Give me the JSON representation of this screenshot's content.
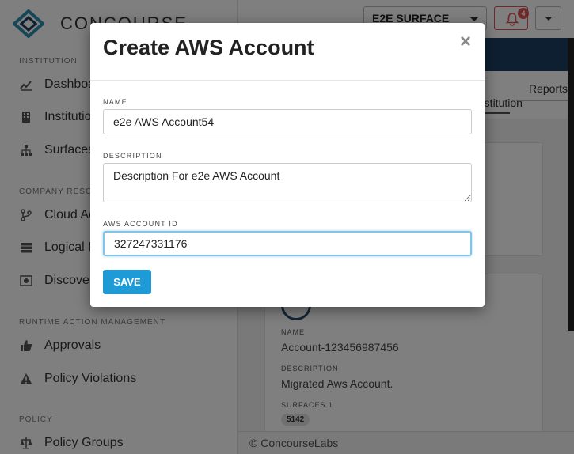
{
  "app": {
    "logo_text": "CONCOURSE"
  },
  "topbar": {
    "surface_select": "E2E SURFACE",
    "notification_count": "4"
  },
  "sidebar": {
    "sections": [
      {
        "label": "INSTITUTION",
        "items": [
          {
            "label": "Dashboard",
            "icon": "chart-line-icon"
          },
          {
            "label": "Institution",
            "icon": "building-icon"
          },
          {
            "label": "Surfaces",
            "icon": "sitemap-icon"
          }
        ]
      },
      {
        "label": "COMPANY RESOURCES",
        "items": [
          {
            "label": "Cloud Accounts",
            "icon": "branch-icon"
          },
          {
            "label": "Logical Deployments",
            "icon": "server-icon"
          },
          {
            "label": "Discovery",
            "icon": "discover-icon"
          }
        ]
      },
      {
        "label": "RUNTIME ACTION MANAGEMENT",
        "items": [
          {
            "label": "Approvals",
            "icon": "thumbs-up-icon"
          },
          {
            "label": "Policy Violations",
            "icon": "warning-icon"
          }
        ]
      },
      {
        "label": "POLICY",
        "items": [
          {
            "label": "Policy Groups",
            "icon": "balance-scale-icon"
          }
        ]
      }
    ]
  },
  "main": {
    "tabs": [
      {
        "label": "Institution"
      },
      {
        "label": "Reports"
      }
    ],
    "account_card": {
      "name_label": "NAME",
      "name_value": "Account-123456987456",
      "description_label": "DESCRIPTION",
      "description_value": "Migrated Aws Account.",
      "surfaces_label": "SURFACES 1",
      "surfaces_badge": "5142"
    },
    "footer": "© ConcourseLabs"
  },
  "modal": {
    "title": "Create AWS Account",
    "close_glyph": "×",
    "fields": {
      "name": {
        "label": "NAME",
        "value": "e2e AWS Account54"
      },
      "description": {
        "label": "DESCRIPTION",
        "value": "Description For e2e AWS Account"
      },
      "aws_account_id": {
        "label": "AWS ACCOUNT ID",
        "value": "327247331176"
      }
    },
    "save_label": "SAVE"
  },
  "colors": {
    "primary": "#1e9ad6",
    "hero": "#1d3e63",
    "alert": "#d9534f"
  }
}
